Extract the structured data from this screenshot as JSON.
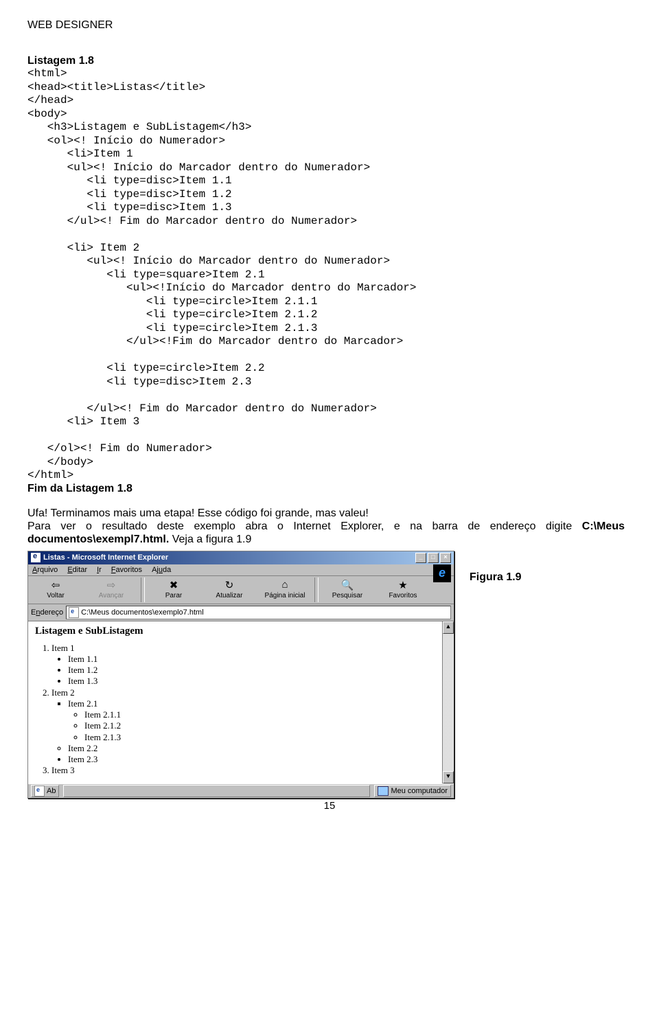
{
  "header": "WEB DESIGNER",
  "listing_title": "Listagem 1.8",
  "code_lines": [
    "<html>",
    "<head><title>Listas</title>",
    "</head>",
    "<body>",
    "   <h3>Listagem e SubListagem</h3>",
    "   <ol><! Início do Numerador>",
    "      <li>Item 1",
    "      <ul><! Início do Marcador dentro do Numerador>",
    "         <li type=disc>Item 1.1",
    "         <li type=disc>Item 1.2",
    "         <li type=disc>Item 1.3",
    "      </ul><! Fim do Marcador dentro do Numerador>",
    "",
    "      <li> Item 2",
    "         <ul><! Início do Marcador dentro do Numerador>",
    "            <li type=square>Item 2.1",
    "               <ul><!Início do Marcador dentro do Marcador>",
    "                  <li type=circle>Item 2.1.1",
    "                  <li type=circle>Item 2.1.2",
    "                  <li type=circle>Item 2.1.3",
    "               </ul><!Fim do Marcador dentro do Marcador>",
    "",
    "            <li type=circle>Item 2.2",
    "            <li type=disc>Item 2.3",
    "",
    "         </ul><! Fim do Marcador dentro do Numerador>",
    "      <li> Item 3",
    "",
    "   </ol><! Fim do Numerador>",
    "   </body>",
    "</html>"
  ],
  "listing_end": "Fim da Listagem 1.8",
  "para1": "Ufa! Terminamos mais uma etapa! Esse código foi grande, mas valeu!",
  "para2_a": "Para ver o resultado deste exemplo abra o Internet Explorer, e na barra de endereço digite ",
  "para2_bold": "C:\\Meus documentos\\exempl7.html.",
  "para2_b": " Veja a figura 1.9",
  "browser": {
    "title": "Listas - Microsoft Internet Explorer",
    "menus": [
      "Arquivo",
      "Editar",
      "Ir",
      "Favoritos",
      "Ajuda"
    ],
    "tools": {
      "back": "Voltar",
      "forward": "Avançar",
      "stop": "Parar",
      "refresh": "Atualizar",
      "home": "Página inicial",
      "search": "Pesquisar",
      "favorites": "Favoritos"
    },
    "addr_label": "Endereço",
    "addr_value": "C:\\Meus documentos\\exemplo7.html",
    "page_heading": "Listagem e SubListagem",
    "ol": {
      "i1": "Item 1",
      "i11": "Item 1.1",
      "i12": "Item 1.2",
      "i13": "Item 1.3",
      "i2": "Item 2",
      "i21": "Item 2.1",
      "i211": "Item 2.1.1",
      "i212": "Item 2.1.2",
      "i213": "Item 2.1.3",
      "i22": "Item 2.2",
      "i23": "Item 2.3",
      "i3": "Item 3"
    },
    "status_left": "Ab",
    "status_right": "Meu computador"
  },
  "figure_label": "Figura 1.9",
  "page_number": "15"
}
